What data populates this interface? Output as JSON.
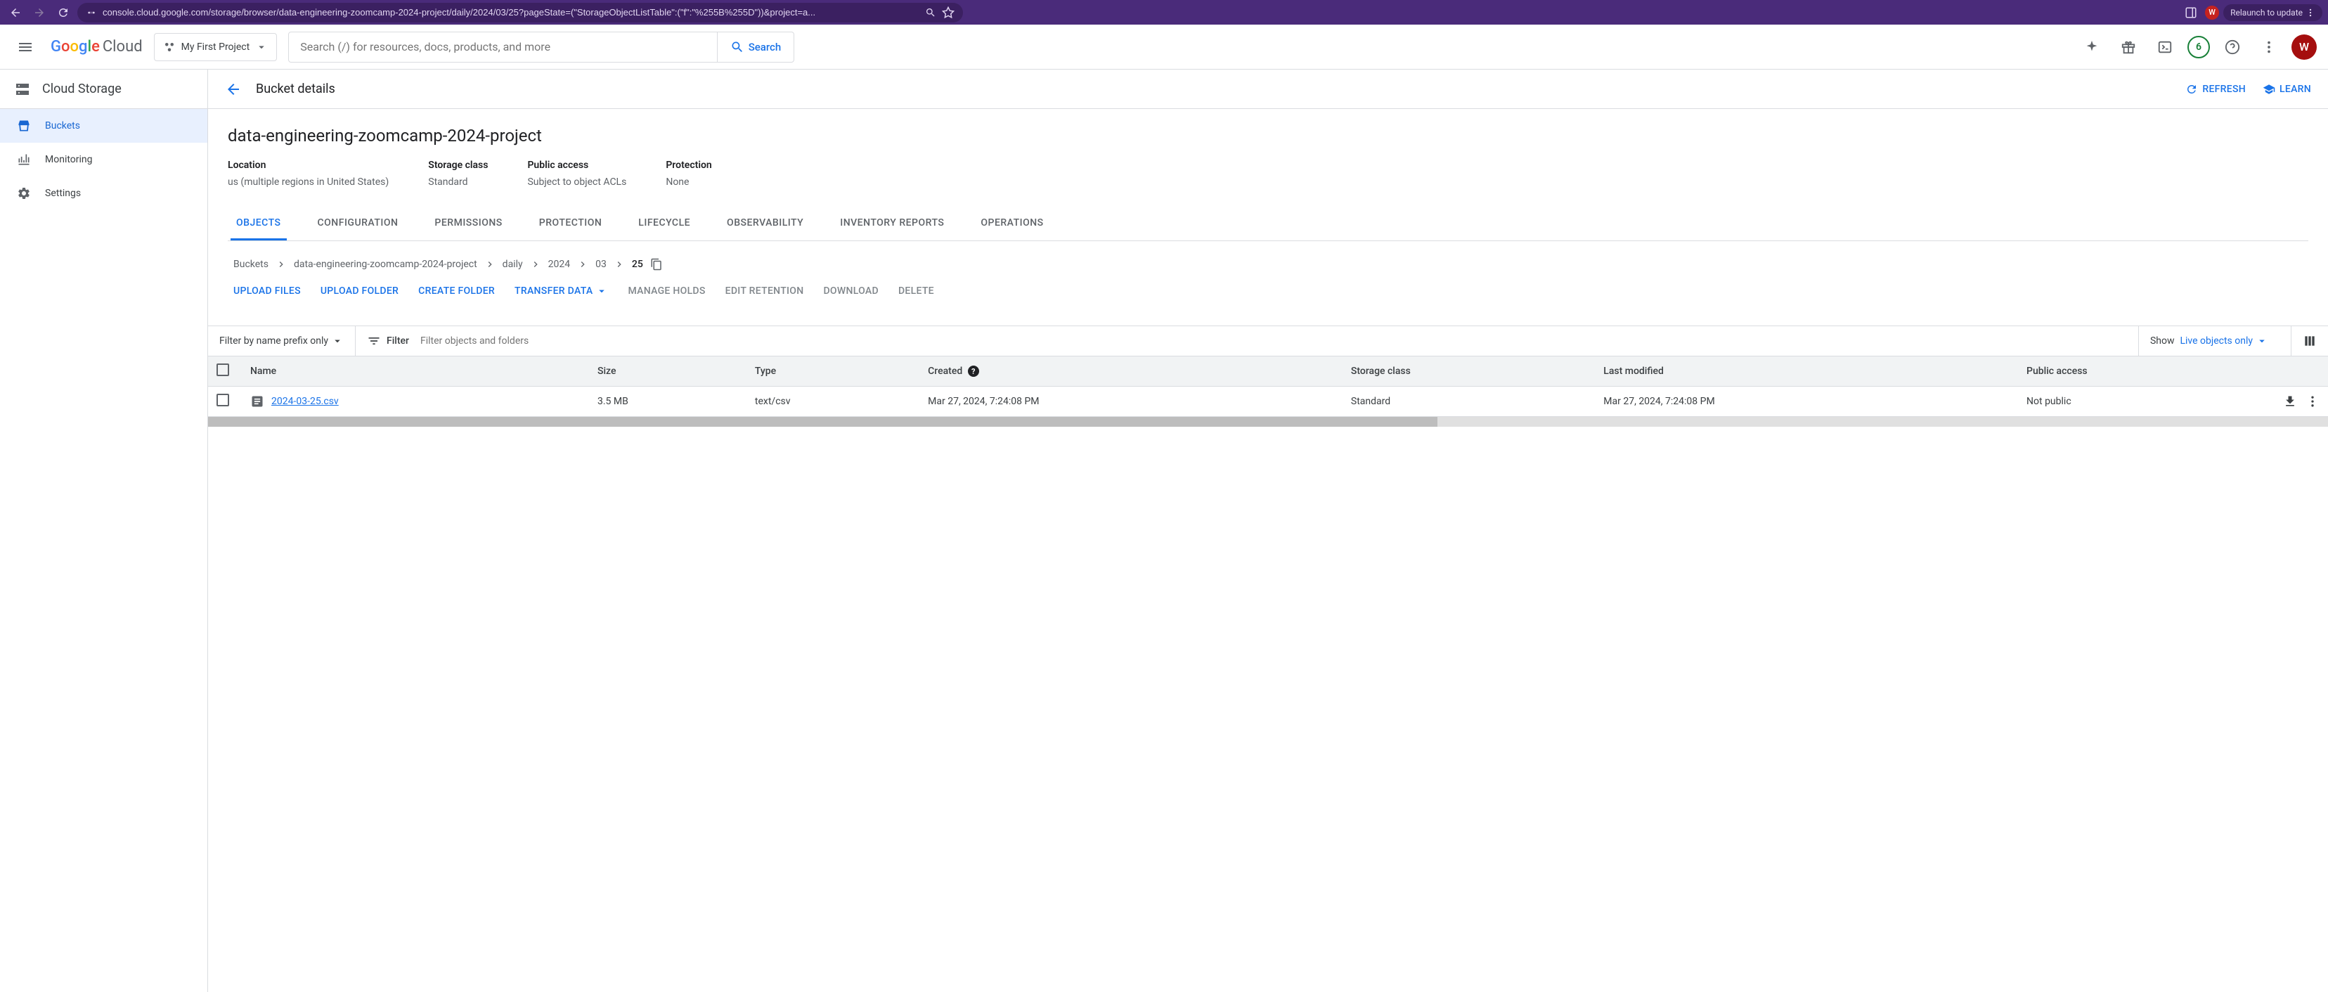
{
  "browser": {
    "url": "console.cloud.google.com/storage/browser/data-engineering-zoomcamp-2024-project/daily/2024/03/25?pageState=(\"StorageObjectListTable\":(\"f\":\"%255B%255D\"))&project=a...",
    "relaunch": "Relaunch to update",
    "profile_initial": "W"
  },
  "topbar": {
    "logo_cloud": "Cloud",
    "project": "My First Project",
    "search_placeholder": "Search (/) for resources, docs, products, and more",
    "search_btn": "Search",
    "notif_count": "6",
    "avatar_initial": "W"
  },
  "sidebar": {
    "product": "Cloud Storage",
    "items": [
      {
        "label": "Buckets"
      },
      {
        "label": "Monitoring"
      },
      {
        "label": "Settings"
      }
    ]
  },
  "header": {
    "title": "Bucket details",
    "refresh": "REFRESH",
    "learn": "LEARN"
  },
  "bucket": {
    "name": "data-engineering-zoomcamp-2024-project",
    "info": {
      "location_label": "Location",
      "location_value": "us (multiple regions in United States)",
      "storage_class_label": "Storage class",
      "storage_class_value": "Standard",
      "public_access_label": "Public access",
      "public_access_value": "Subject to object ACLs",
      "protection_label": "Protection",
      "protection_value": "None"
    }
  },
  "tabs": [
    "OBJECTS",
    "CONFIGURATION",
    "PERMISSIONS",
    "PROTECTION",
    "LIFECYCLE",
    "OBSERVABILITY",
    "INVENTORY REPORTS",
    "OPERATIONS"
  ],
  "breadcrumb": {
    "root": "Buckets",
    "parts": [
      "data-engineering-zoomcamp-2024-project",
      "daily",
      "2024",
      "03"
    ],
    "current": "25"
  },
  "actions": {
    "upload_files": "UPLOAD FILES",
    "upload_folder": "UPLOAD FOLDER",
    "create_folder": "CREATE FOLDER",
    "transfer_data": "TRANSFER DATA",
    "manage_holds": "MANAGE HOLDS",
    "edit_retention": "EDIT RETENTION",
    "download": "DOWNLOAD",
    "delete": "DELETE"
  },
  "filter": {
    "prefix": "Filter by name prefix only",
    "label": "Filter",
    "placeholder": "Filter objects and folders",
    "show": "Show",
    "show_value": "Live objects only"
  },
  "table": {
    "headers": {
      "name": "Name",
      "size": "Size",
      "type": "Type",
      "created": "Created",
      "storage_class": "Storage class",
      "last_modified": "Last modified",
      "public_access": "Public access"
    },
    "rows": [
      {
        "name": "2024-03-25.csv",
        "size": "3.5 MB",
        "type": "text/csv",
        "created": "Mar 27, 2024, 7:24:08 PM",
        "storage_class": "Standard",
        "last_modified": "Mar 27, 2024, 7:24:08 PM",
        "public_access": "Not public"
      }
    ]
  }
}
